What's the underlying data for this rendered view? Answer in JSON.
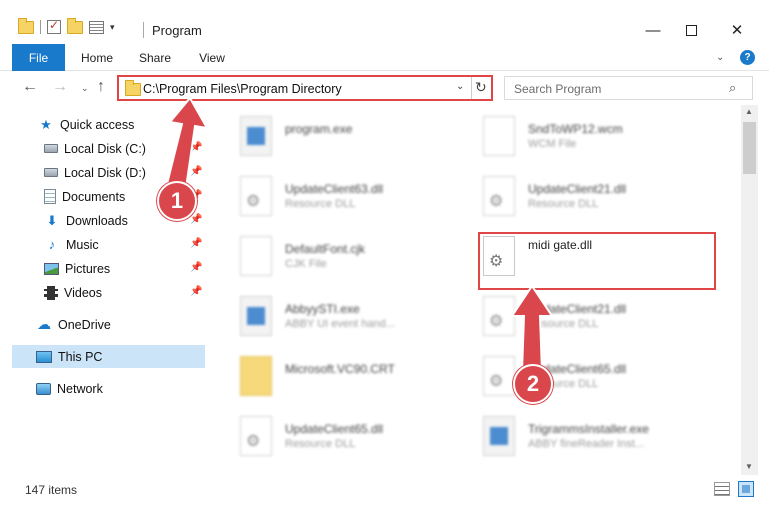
{
  "window": {
    "title": "Program",
    "minimize": "—",
    "close": "✕"
  },
  "ribbon": {
    "tabs": [
      "File",
      "Home",
      "Share",
      "View"
    ],
    "expand": "⌄",
    "help": "?"
  },
  "nav": {
    "back": "←",
    "forward": "→",
    "recent": "⌄",
    "up": "↑",
    "address": "C:\\Program Files\\Program Directory",
    "address_dropdown": "⌄",
    "refresh": "↻",
    "search_placeholder": "Search Program",
    "search_icon": "⌕"
  },
  "sidebar": {
    "items": [
      {
        "label": "Quick access",
        "icon": "star-icon",
        "glyph": "★"
      },
      {
        "label": "Local Disk (C:)",
        "icon": "disk-icon",
        "pinned": true
      },
      {
        "label": "Local Disk (D:)",
        "icon": "disk-icon",
        "pinned": true
      },
      {
        "label": "Documents",
        "icon": "documents-icon",
        "pinned": true
      },
      {
        "label": "Downloads",
        "icon": "downloads-icon",
        "glyph": "⬇",
        "pinned": true
      },
      {
        "label": "Music",
        "icon": "music-icon",
        "glyph": "♪",
        "pinned": true
      },
      {
        "label": "Pictures",
        "icon": "pictures-icon",
        "pinned": true
      },
      {
        "label": "Videos",
        "icon": "videos-icon",
        "pinned": true
      },
      {
        "label": "OneDrive",
        "icon": "onedrive-icon",
        "glyph": "☁"
      },
      {
        "label": "This PC",
        "icon": "this-pc-icon",
        "selected": true
      },
      {
        "label": "Network",
        "icon": "network-icon"
      }
    ],
    "pin_glyph": "📌"
  },
  "files": [
    {
      "name": "program.exe",
      "type": "",
      "icon": "exe-icon"
    },
    {
      "name": "SndToWP12.wcm",
      "type": "WCM File",
      "icon": "file-icon"
    },
    {
      "name": "UpdateClient63.dll",
      "type": "Resource DLL",
      "icon": "dll-icon"
    },
    {
      "name": "UpdateClient21.dll",
      "type": "Resource DLL",
      "icon": "dll-icon"
    },
    {
      "name": "DefaultFont.cjk",
      "type": "CJK File",
      "icon": "file-icon"
    },
    {
      "name": "midi gate.dll",
      "type": "",
      "icon": "dll-icon"
    },
    {
      "name": "AbbyySTI.exe",
      "type": "ABBY UI event hand...",
      "icon": "exe-icon"
    },
    {
      "name": "UpdateClient21.dll",
      "type": "Resource DLL",
      "icon": "dll-icon"
    },
    {
      "name": "Microsoft.VC90.CRT",
      "type": "",
      "icon": "folder-icon"
    },
    {
      "name": "UpdateClient65.dll",
      "type": "Resource DLL",
      "icon": "dll-icon"
    },
    {
      "name": "UpdateClient65.dll",
      "type": "Resource DLL",
      "icon": "dll-icon"
    },
    {
      "name": "TrigrammsInstaller.exe",
      "type": "ABBY fineReader Inst...",
      "icon": "exe-icon"
    }
  ],
  "annotations": {
    "badge_1": "1",
    "badge_2": "2",
    "color": "#e04646"
  },
  "scrollbar": {
    "up": "▲",
    "down": "▼"
  },
  "status": {
    "item_count": "147 items"
  },
  "colors": {
    "accent": "#1979ca",
    "selection": "#cce4f7",
    "annotation": "#e04646"
  }
}
